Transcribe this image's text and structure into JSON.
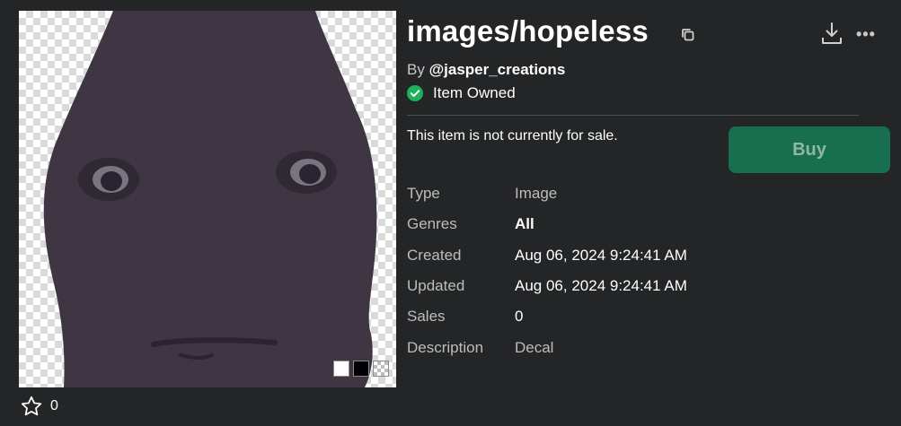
{
  "item": {
    "title": "images/hopeless",
    "by_prefix": "By ",
    "creator": "@jasper_creations",
    "owned_text": "Item Owned",
    "sale_message": "This item is not currently for sale.",
    "buy_label": "Buy",
    "favorite_count": "0"
  },
  "details": [
    {
      "label": "Type",
      "value": "Image"
    },
    {
      "label": "Genres",
      "value": "All"
    },
    {
      "label": "Created",
      "value": "Aug 06, 2024 9:24:41 AM"
    },
    {
      "label": "Updated",
      "value": "Aug 06, 2024 9:24:41 AM"
    },
    {
      "label": "Sales",
      "value": "0"
    },
    {
      "label": "Description",
      "value": "Decal"
    }
  ],
  "icons": {
    "copy": "copy-icon",
    "download": "download-icon",
    "more": "more-icon",
    "owned": "check-circle-icon",
    "favorite": "star-outline-icon"
  },
  "colors": {
    "background": "#232527",
    "buy_button": "#176f4f",
    "owned_check": "#1fb05a",
    "divider": "#4b4d50"
  }
}
